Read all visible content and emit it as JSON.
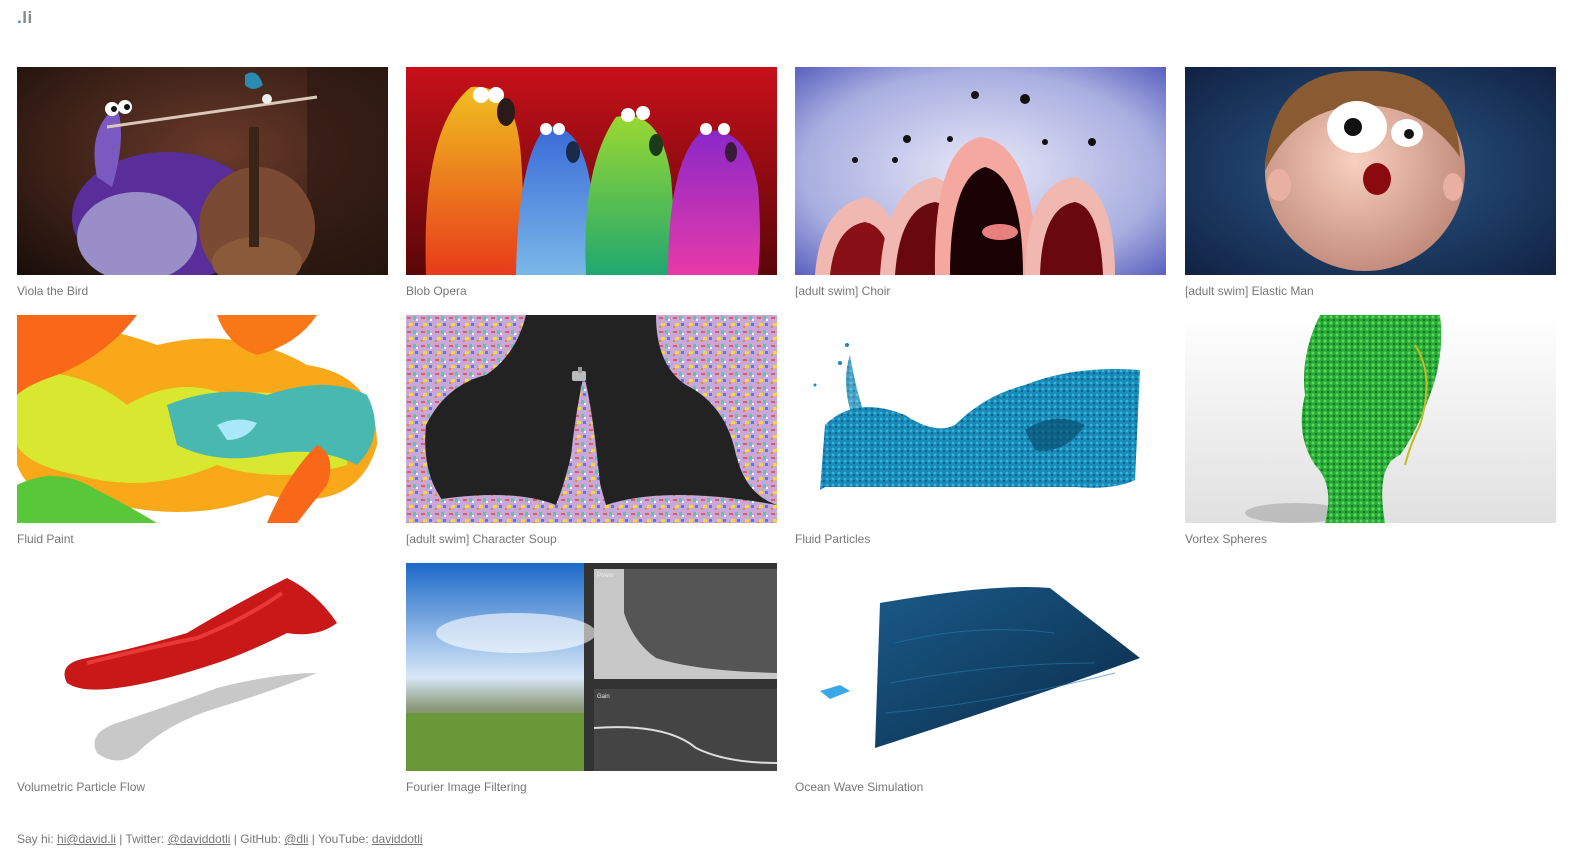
{
  "site": {
    "logo_dot": ".",
    "logo_text": "li"
  },
  "projects": [
    {
      "title": "Viola the Bird"
    },
    {
      "title": "Blob Opera"
    },
    {
      "title": "[adult swim] Choir"
    },
    {
      "title": "[adult swim] Elastic Man"
    },
    {
      "title": "Fluid Paint"
    },
    {
      "title": "[adult swim] Character Soup"
    },
    {
      "title": "Fluid Particles"
    },
    {
      "title": "Vortex Spheres"
    },
    {
      "title": "Volumetric Particle Flow"
    },
    {
      "title": "Fourier Image Filtering",
      "thumb_labels": {
        "power": "Power",
        "gain": "Gain"
      }
    },
    {
      "title": "Ocean Wave Simulation"
    }
  ],
  "footer": {
    "sayhi_label": "Say hi:",
    "email": "hi@david.li",
    "sep1": "|",
    "twitter_label": "Twitter:",
    "twitter": "@daviddotli",
    "sep2": "|",
    "github_label": "GitHub:",
    "github": "@dli",
    "sep3": "|",
    "youtube_label": "YouTube:",
    "youtube": "daviddotli"
  },
  "colors": {
    "accent": "#4a90c8",
    "text": "#777777"
  }
}
